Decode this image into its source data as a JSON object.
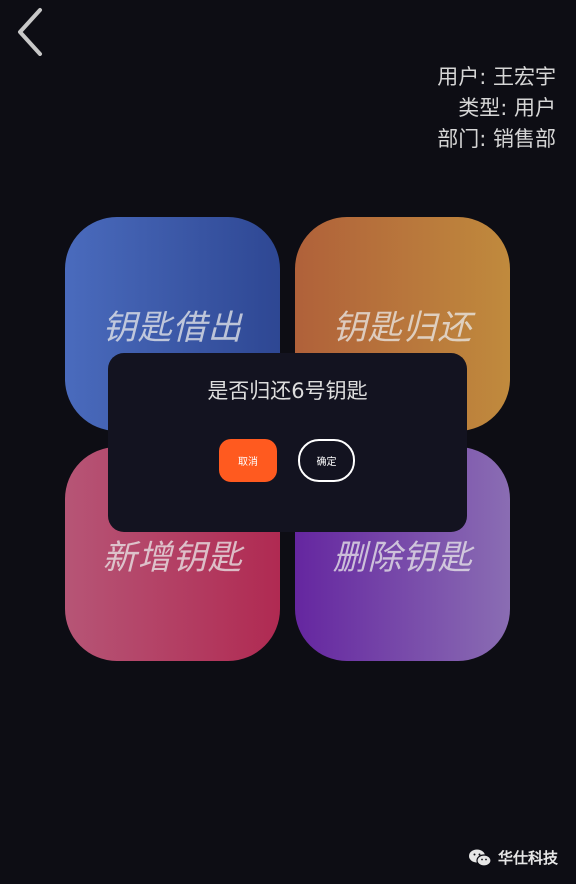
{
  "user": {
    "name_line": "用户: 王宏宇",
    "type_line": "类型:   用户",
    "dept_line": "部门: 销售部"
  },
  "tiles": {
    "borrow": "钥匙借出",
    "return": "钥匙归还",
    "add": "新增钥匙",
    "delete": "删除钥匙"
  },
  "dialog": {
    "message": "是否归还6号钥匙",
    "cancel_label": "取消",
    "confirm_label": "确定"
  },
  "watermark": {
    "text": "华仕科技"
  },
  "colors": {
    "background": "#0d0d14",
    "cancel_button": "#ff5a1f",
    "dialog_bg": "#131320"
  }
}
